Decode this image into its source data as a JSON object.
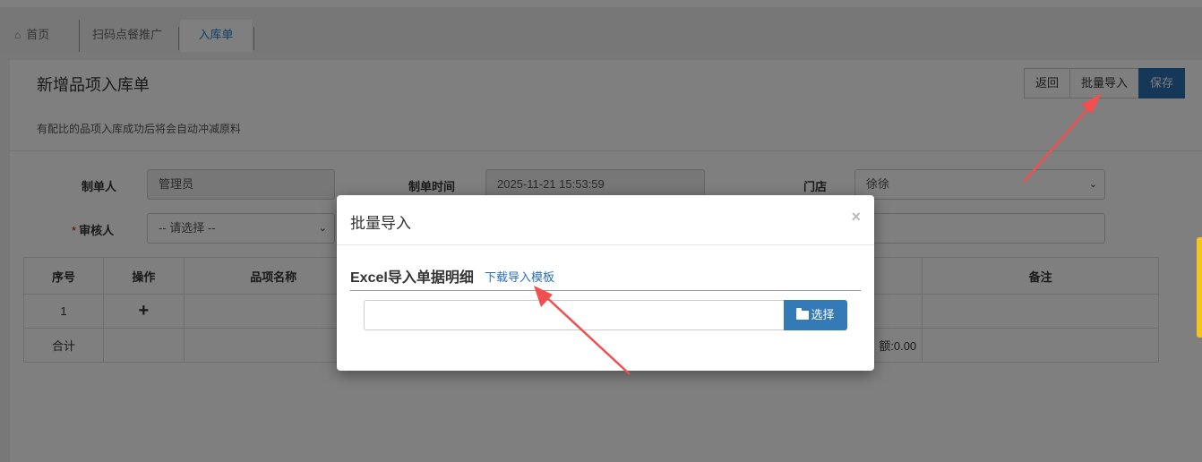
{
  "tabs": [
    {
      "label": "首页",
      "icon": "home-icon"
    },
    {
      "label": "扫码点餐推广"
    },
    {
      "label": "入库单"
    }
  ],
  "page": {
    "title": "新增品项入库单",
    "subtitle": "有配比的品项入库成功后将会自动冲减原料",
    "buttons": {
      "back": "返回",
      "import": "批量导入",
      "save": "保存"
    }
  },
  "form": {
    "creator_label": "制单人",
    "creator_value": "管理员",
    "time_label": "制单时间",
    "time_value": "2025-11-21 15:53:59",
    "store_label": "门店",
    "store_value": "徐徐",
    "reviewer_required": "*",
    "reviewer_label": "审核人",
    "reviewer_value": "-- 请选择 --"
  },
  "grid": {
    "headers": {
      "index": "序号",
      "action": "操作",
      "item_name": "品项名称",
      "remark": "备注"
    },
    "row_index": "1",
    "add_symbol": "+",
    "total_label": "合计",
    "amount_text": "额:0.00"
  },
  "modal": {
    "title": "批量导入",
    "close": "×",
    "section": "Excel导入单据明细",
    "download_link": "下载导入模板",
    "choose_label": "选择"
  },
  "colors": {
    "primary": "#2a6fb0",
    "annotation_arrow": "#f05050",
    "required": "#cc0000"
  }
}
